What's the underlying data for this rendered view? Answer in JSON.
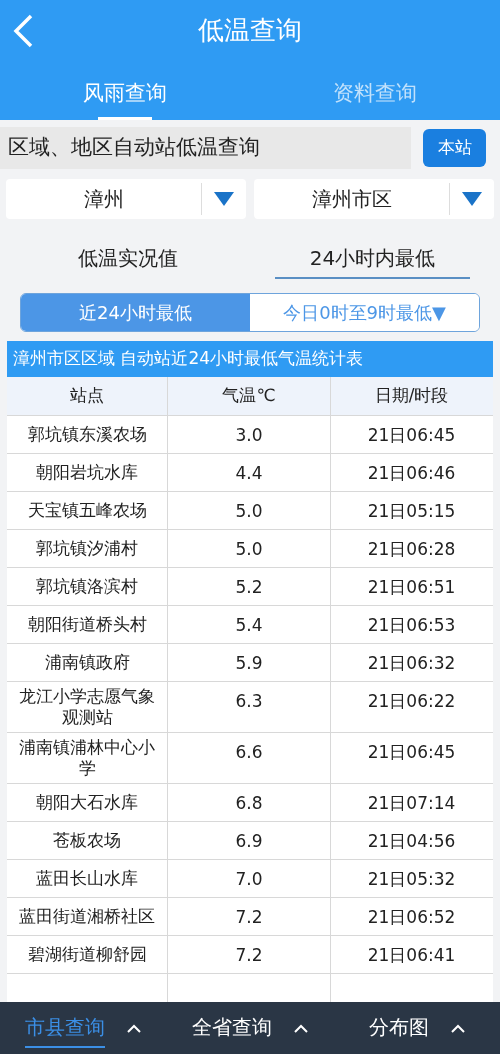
{
  "header": {
    "title": "低温查询"
  },
  "tabs": [
    {
      "label": "风雨查询",
      "selected": true
    },
    {
      "label": "资料查询",
      "selected": false
    }
  ],
  "query_bar": {
    "title": "区域、地区自动站低温查询",
    "button": "本站"
  },
  "dropdowns": [
    {
      "value": "漳州"
    },
    {
      "value": "漳州市区"
    }
  ],
  "modes": [
    {
      "label": "低温实况值",
      "selected": false
    },
    {
      "label": "24小时内最低",
      "selected": true
    }
  ],
  "segments": [
    {
      "label": "近24小时最低",
      "selected": true
    },
    {
      "label": "今日0时至9时最低▼",
      "selected": false
    }
  ],
  "table": {
    "title": "漳州市区区域 自动站近24小时最低气温统计表",
    "columns": [
      "站点",
      "气温℃",
      "日期/时段"
    ],
    "rows": [
      {
        "station": "郭坑镇东溪农场",
        "temp": "3.0",
        "time": "21日06:45"
      },
      {
        "station": "朝阳岩坑水库",
        "temp": "4.4",
        "time": "21日06:46"
      },
      {
        "station": "天宝镇五峰农场",
        "temp": "5.0",
        "time": "21日05:15"
      },
      {
        "station": "郭坑镇汐浦村",
        "temp": "5.0",
        "time": "21日06:28"
      },
      {
        "station": "郭坑镇洛滨村",
        "temp": "5.2",
        "time": "21日06:51"
      },
      {
        "station": "朝阳街道桥头村",
        "temp": "5.4",
        "time": "21日06:53"
      },
      {
        "station": "浦南镇政府",
        "temp": "5.9",
        "time": "21日06:32"
      },
      {
        "station": "龙江小学志愿气象观测站",
        "temp": "6.3",
        "time": "21日06:22"
      },
      {
        "station": "浦南镇浦林中心小学",
        "temp": "6.6",
        "time": "21日06:45"
      },
      {
        "station": "朝阳大石水库",
        "temp": "6.8",
        "time": "21日07:14"
      },
      {
        "station": "苍板农场",
        "temp": "6.9",
        "time": "21日04:56"
      },
      {
        "station": "蓝田长山水库",
        "temp": "7.0",
        "time": "21日05:32"
      },
      {
        "station": "蓝田街道湘桥社区",
        "temp": "7.2",
        "time": "21日06:52"
      },
      {
        "station": "碧湖街道柳舒园",
        "temp": "7.2",
        "time": "21日06:41"
      }
    ]
  },
  "bottom_nav": [
    {
      "label": "市县查询",
      "selected": true
    },
    {
      "label": "全省查询",
      "selected": false
    },
    {
      "label": "分布图",
      "selected": false
    }
  ]
}
